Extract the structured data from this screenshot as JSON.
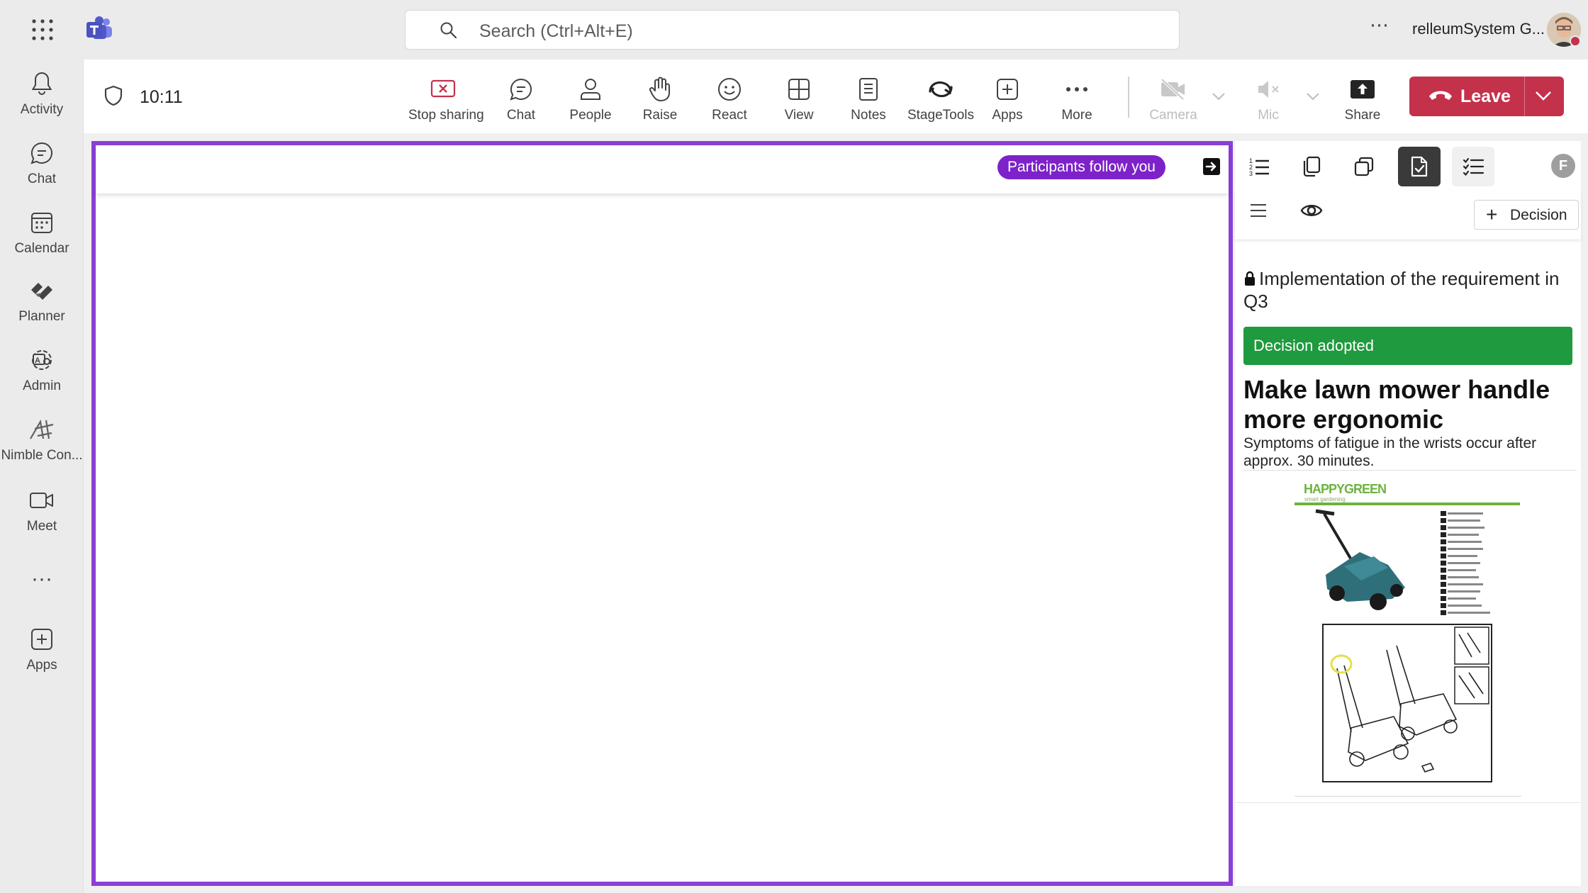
{
  "topbar": {
    "search_placeholder": "Search (Ctrl+Alt+E)",
    "more_label": "···",
    "user_name": "relleumSystem G..."
  },
  "rail": {
    "items": [
      {
        "label": "Activity",
        "icon": "bell-icon"
      },
      {
        "label": "Chat",
        "icon": "chat-icon"
      },
      {
        "label": "Calendar",
        "icon": "calendar-icon"
      },
      {
        "label": "Planner",
        "icon": "planner-icon"
      },
      {
        "label": "Admin",
        "icon": "admin-icon"
      },
      {
        "label": "Nimble Con...",
        "icon": "nimble-icon"
      },
      {
        "label": "Meet",
        "icon": "video-camera-icon"
      }
    ],
    "more_dots": "···",
    "apps_label": "Apps"
  },
  "meeting": {
    "time": "10:11",
    "toolbar": [
      {
        "label": "Stop sharing",
        "icon": "stop-sharing-icon"
      },
      {
        "label": "Chat",
        "icon": "chat-icon"
      },
      {
        "label": "People",
        "icon": "people-icon"
      },
      {
        "label": "Raise",
        "icon": "raise-hand-icon"
      },
      {
        "label": "React",
        "icon": "smiley-icon"
      },
      {
        "label": "View",
        "icon": "view-grid-icon"
      },
      {
        "label": "Notes",
        "icon": "notes-icon"
      },
      {
        "label": "StageTools",
        "icon": "stagetools-icon"
      },
      {
        "label": "Apps",
        "icon": "add-app-icon"
      },
      {
        "label": "More",
        "icon": "more-dots-icon"
      }
    ],
    "camera_label": "Camera",
    "mic_label": "Mic",
    "share_label": "Share",
    "leave_label": "Leave",
    "colors": {
      "leave": "#c4314b",
      "stage_border": "#8b3fd6",
      "follow_pill": "#7d22c9",
      "adopted": "#1f9a3e"
    }
  },
  "stage": {
    "follow_text": "Participants follow you"
  },
  "panel": {
    "avatar_initial": "F",
    "decision_button_label": "Decision",
    "requirement_title": "Implementation of the requirement in Q3",
    "status_banner": "Decision adopted",
    "item_title": "Make lawn mower handle more ergonomic",
    "item_description": "Symptoms of fatigue in the wrists occur after approx. 30 minutes.",
    "manual_brand": "HAPPYGREEN",
    "manual_tagline": "smart gardening"
  }
}
